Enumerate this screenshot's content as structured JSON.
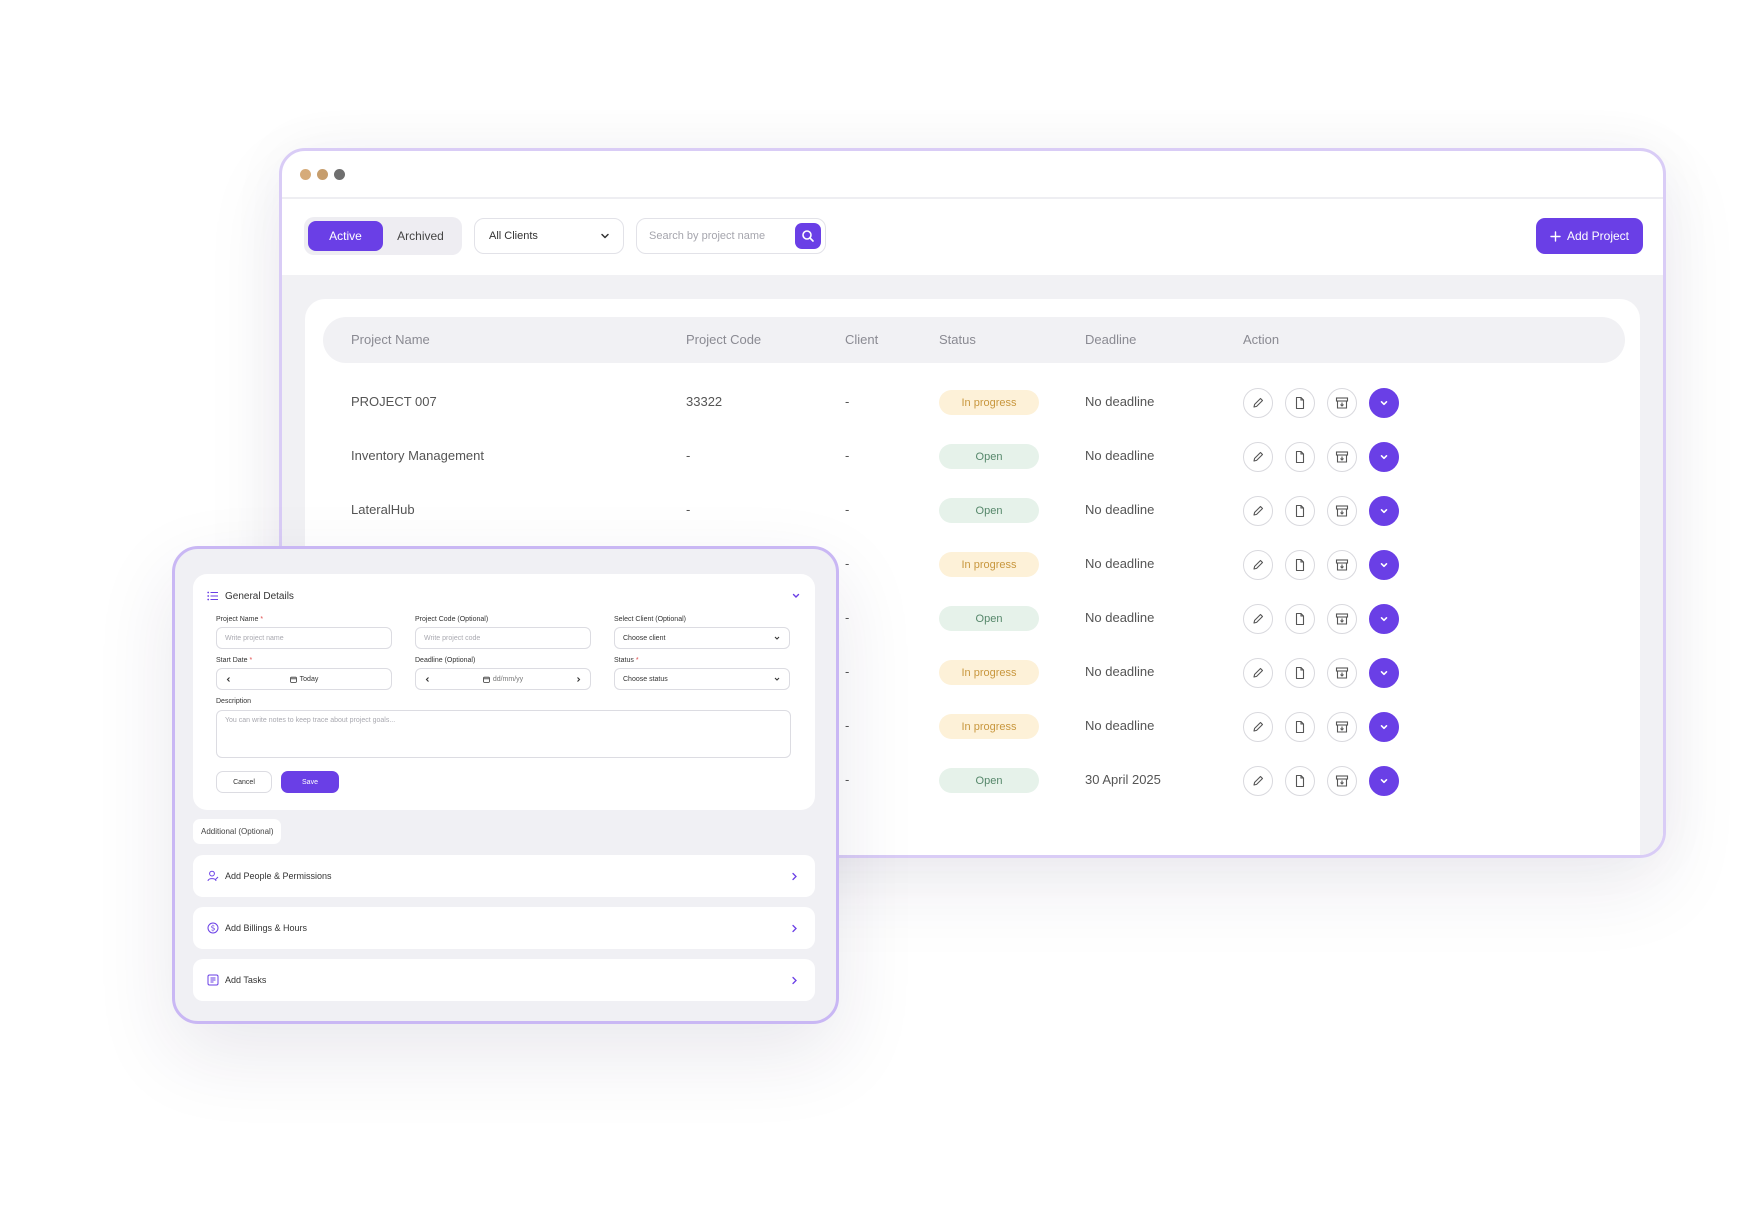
{
  "window": {
    "dots": [
      "#d6ab79",
      "#c69d6c",
      "#6f6f6f"
    ]
  },
  "toolbar": {
    "tab_active": "Active",
    "tab_archived": "Archived",
    "client_filter": "All Clients",
    "search_placeholder": "Search by project name",
    "add_project": "Add Project"
  },
  "table": {
    "headers": [
      "Project Name",
      "Project Code",
      "Client",
      "Status",
      "Deadline",
      "Action"
    ],
    "rows": [
      {
        "name": "PROJECT 007",
        "code": "33322",
        "client": "-",
        "status": "In progress",
        "status_kind": "prog",
        "deadline": "No deadline"
      },
      {
        "name": "Inventory Management",
        "code": "-",
        "client": "-",
        "status": "Open",
        "status_kind": "open",
        "deadline": "No deadline"
      },
      {
        "name": "LateralHub",
        "code": "-",
        "client": "-",
        "status": "Open",
        "status_kind": "open",
        "deadline": "No deadline"
      },
      {
        "name": "",
        "code": "",
        "client": "-",
        "status": "In progress",
        "status_kind": "prog",
        "deadline": "No deadline"
      },
      {
        "name": "",
        "code": "",
        "client": "-",
        "status": "Open",
        "status_kind": "open",
        "deadline": "No deadline"
      },
      {
        "name": "",
        "code": "",
        "client": "-",
        "status": "In progress",
        "status_kind": "prog",
        "deadline": "No deadline"
      },
      {
        "name": "",
        "code": "",
        "client": "-",
        "status": "In progress",
        "status_kind": "prog",
        "deadline": "No deadline"
      },
      {
        "name": "",
        "code": "",
        "client": "-",
        "status": "Open",
        "status_kind": "open",
        "deadline": "30 April 2025"
      }
    ],
    "action_icons": [
      "edit-icon",
      "document-icon",
      "archive-icon",
      "expand-icon"
    ]
  },
  "form": {
    "section_title": "General Details",
    "project_name_label": "Project Name",
    "project_name_placeholder": "Write project name",
    "project_code_label": "Project Code (Optional)",
    "project_code_placeholder": "Write project code",
    "client_label": "Select Client (Optional)",
    "client_value": "Choose client",
    "start_date_label": "Start Date",
    "start_date_value": "Today",
    "deadline_label": "Deadline (Optional)",
    "deadline_value": "dd/mm/yy",
    "status_label": "Status",
    "status_value": "Choose status",
    "description_label": "Description",
    "description_placeholder": "You can write notes to keep trace about project goals...",
    "required_mark": "*",
    "cancel": "Cancel",
    "save": "Save",
    "additional_tag": "Additional (Optional)",
    "sections": [
      {
        "label": "Add People & Permissions",
        "icon": "person-icon"
      },
      {
        "label": "Add Billings & Hours",
        "icon": "dollar-icon"
      },
      {
        "label": "Add Tasks",
        "icon": "tasks-icon"
      }
    ]
  }
}
